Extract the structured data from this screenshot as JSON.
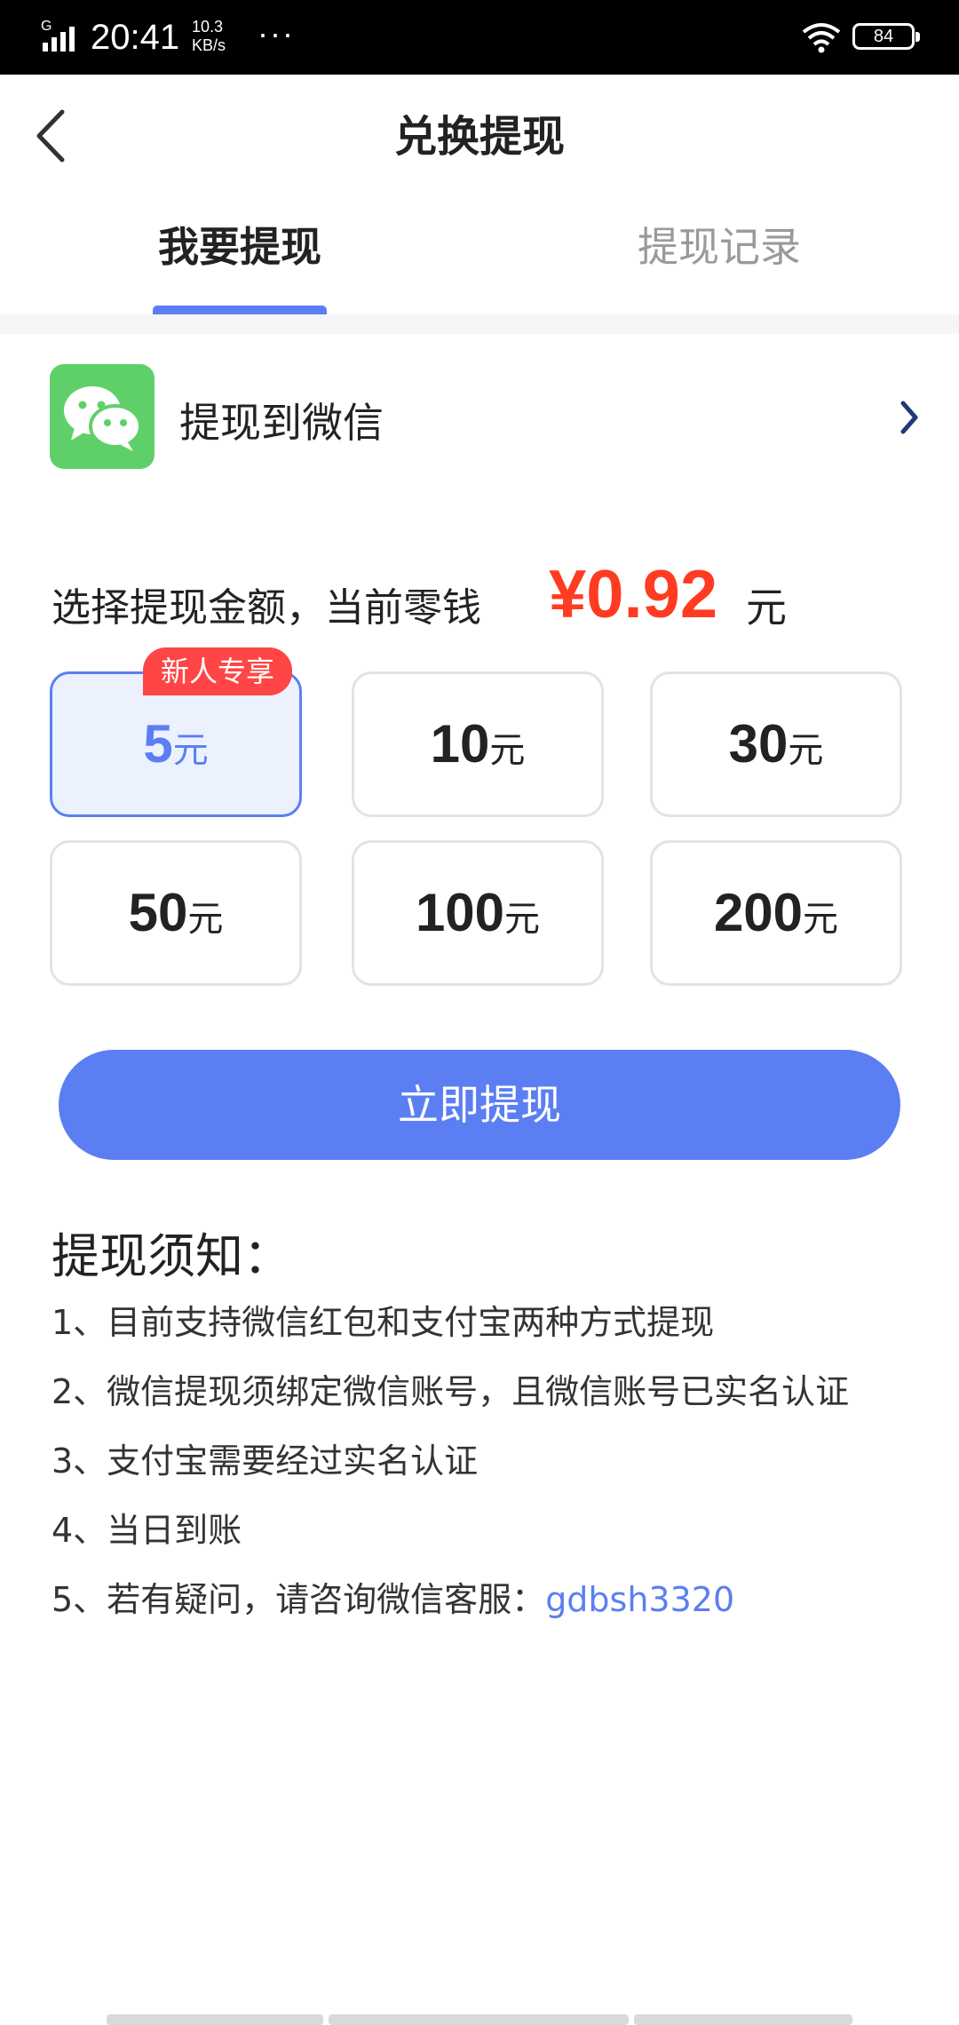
{
  "status_bar": {
    "time": "20:41",
    "network_speed_value": "10.3",
    "network_speed_unit": "KB/s",
    "more": "···",
    "battery": "84",
    "network_type": "G"
  },
  "header": {
    "title": "兑换提现"
  },
  "tabs": [
    {
      "label": "我要提现",
      "active": true
    },
    {
      "label": "提现记录",
      "active": false
    }
  ],
  "wechat": {
    "label": "提现到微信"
  },
  "amount": {
    "label": "选择提现金额，当前零钱",
    "value": "¥0.92",
    "unit": "元"
  },
  "options": [
    {
      "value": "5",
      "unit": "元",
      "selected": true,
      "badge": "新人专享"
    },
    {
      "value": "10",
      "unit": "元",
      "selected": false
    },
    {
      "value": "30",
      "unit": "元",
      "selected": false
    },
    {
      "value": "50",
      "unit": "元",
      "selected": false
    },
    {
      "value": "100",
      "unit": "元",
      "selected": false
    },
    {
      "value": "200",
      "unit": "元",
      "selected": false
    }
  ],
  "withdraw_button": {
    "label": "立即提现"
  },
  "notes": {
    "title": "提现须知：",
    "items": [
      "1、目前支持微信红包和支付宝两种方式提现",
      "2、微信提现须绑定微信账号，且微信账号已实名认证",
      "3、支付宝需要经过实名认证",
      "4、当日到账"
    ],
    "last_item_prefix": "5、若有疑问，请咨询微信客服：",
    "last_item_link": "gdbsh3320"
  },
  "colors": {
    "accent": "#5b7ff2",
    "amount": "#ff3b22",
    "badge": "#ff4545",
    "wechat": "#5fd069"
  }
}
